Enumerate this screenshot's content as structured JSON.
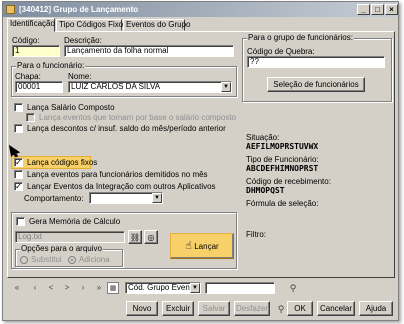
{
  "window": {
    "title": "[340412] Grupo de Lançamento",
    "controls": [
      "_",
      "□",
      "×"
    ]
  },
  "tabs": [
    {
      "label": "Identificação",
      "active": true
    },
    {
      "label": "Tipo Códigos Fixos",
      "active": false
    },
    {
      "label": "Eventos do Grupo",
      "active": false
    }
  ],
  "form": {
    "codigo_label": "Código:",
    "codigo_value": "1",
    "descricao_label": "Descrição:",
    "descricao_value": "Lançamento da folha normal"
  },
  "funcionario": {
    "group_title": "Para o funcionário:",
    "chapa_label": "Chapa:",
    "chapa_value": "00001",
    "nome_label": "Nome:",
    "nome_value": "LUIZ CARLOS DA SILVA"
  },
  "grupo_funcionarios": {
    "group_title": "Para o grupo de funcionários:",
    "codigo_quebra_label": "Código de Quebra:",
    "codigo_quebra_value": "??",
    "selecao_button": "Seleção de funcionários"
  },
  "checkboxes": {
    "salario_composto": {
      "label": "Lança Salário Composto",
      "checked": false,
      "enabled": true
    },
    "eventos_base": {
      "label": "Lança eventos que tomam por base o salário composto",
      "checked": false,
      "enabled": false
    },
    "descontos": {
      "label": "Lança descontos c/ insuf. saldo do mês/período anterior",
      "checked": false,
      "enabled": true
    },
    "codigos_fixos": {
      "label": "Lança códigos fixos",
      "checked": true,
      "enabled": true
    },
    "demitidos": {
      "label": "Lança eventos para funcionários demitidos no mês",
      "checked": false,
      "enabled": true
    },
    "integracao": {
      "label": "Lançar Eventos da Integração com outros Aplicativos",
      "checked": true,
      "enabled": true
    },
    "memoria": {
      "label": "Gera Memória de Cálculo",
      "checked": false,
      "enabled": true
    }
  },
  "comportamento": {
    "label": "Comportamento:",
    "value": ""
  },
  "log": {
    "value": "Log.txt"
  },
  "opcoes_arquivo": {
    "group_title": "Opções para o arquivo",
    "substitui": "Substitui",
    "adiciona": "Adiciona",
    "selected": "adiciona"
  },
  "lancar_button": "Lançar",
  "info": {
    "situacao_label": "Situação:",
    "situacao_value": "AEFILMOPRSTUVWX",
    "tipo_label": "Tipo de Funcionário:",
    "tipo_value": "ABCDEFHIMNOPRST",
    "recebimento_label": "Código de recebimento:",
    "recebimento_value": "DHMOPQST",
    "formula_label": "Fórmula de seleção:",
    "filtro_label": "Filtro:"
  },
  "navigation": {
    "first": "«",
    "prev_page": "‹",
    "prev": "<",
    "next": ">",
    "next_page": "›",
    "last": "»",
    "sort_value": "Cód. Grupo Evento"
  },
  "buttons": {
    "novo": "Novo",
    "excluir": "Excluir",
    "salvar": "Salvar",
    "desfazer": "Desfazer",
    "ok": "OK",
    "cancelar": "Cancelar",
    "ajuda": "Ajuda"
  },
  "colors": {
    "window_bg": "#d4d0c8",
    "highlight": "#f8d06a",
    "code_field": "#ffffcc"
  }
}
